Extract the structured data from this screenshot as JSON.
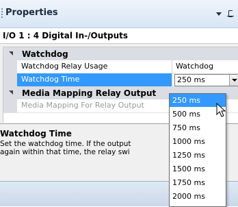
{
  "window": {
    "title": "Properties"
  },
  "object_header": {
    "text": "I/O 1 : 4 Digital In-/Outputs"
  },
  "grid": {
    "categories": [
      {
        "label": "Watchdog",
        "rows": [
          {
            "name": "Watchdog Relay Usage",
            "value": "Watchdog"
          },
          {
            "name": "Watchdog Time",
            "value": "250 ms"
          }
        ]
      },
      {
        "label": "Media Mapping Relay Output",
        "rows": [
          {
            "name": "Media Mapping For Relay Output",
            "value": ""
          }
        ]
      }
    ]
  },
  "description": {
    "title": "Watchdog Time",
    "line1": "Set the watchdog time. If the output",
    "line2": "again within that time, the relay swi"
  },
  "dropdown": {
    "options": [
      "250 ms",
      "500 ms",
      "750 ms",
      "1000 ms",
      "1250 ms",
      "1500 ms",
      "1750 ms",
      "2000 ms"
    ],
    "selected": "250 ms"
  },
  "icons": {
    "title_menu": "chevron-down-icon",
    "pin": "pin-icon",
    "expand": "collapse-triangle-icon",
    "cursor": "mouse-cursor-icon"
  },
  "colors": {
    "selection": "#3399ff",
    "category_bg": "#dadde3",
    "title_bg": "#d9e6f5"
  }
}
